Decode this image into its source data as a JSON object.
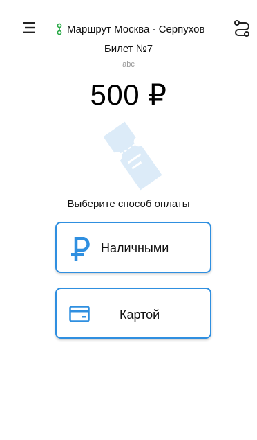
{
  "header": {
    "menu_icon": "menu-icon",
    "route_icon": "route-pin-icon",
    "route_title": "Маршрут Москва - Серпухов",
    "route_switch_icon": "route-switch-icon"
  },
  "ticket": {
    "title": "Билет №7",
    "subtitle": "abc",
    "price": "500 ₽",
    "illustration_icon": "ticket-icon"
  },
  "payment": {
    "prompt": "Выберите способ оплаты",
    "options": [
      {
        "label": "Наличными",
        "icon": "ruble-icon"
      },
      {
        "label": "Картой",
        "icon": "credit-card-icon"
      }
    ]
  },
  "colors": {
    "accent": "#2f8fe0",
    "route_icon": "#27a844",
    "ticket_illustration": "#dcebf8"
  }
}
